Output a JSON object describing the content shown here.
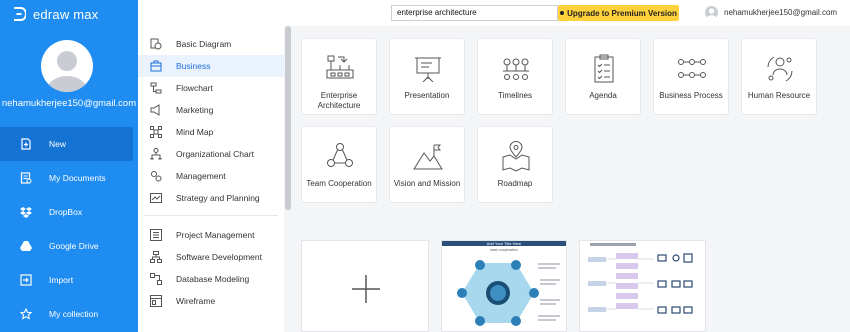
{
  "app": {
    "name": "edraw max"
  },
  "user": {
    "email": "nehamukherjee150@gmail.com"
  },
  "sidebar": {
    "items": [
      {
        "label": "New",
        "icon": "new-file-icon"
      },
      {
        "label": "My Documents",
        "icon": "documents-icon"
      },
      {
        "label": "DropBox",
        "icon": "dropbox-icon"
      },
      {
        "label": "Google Drive",
        "icon": "google-drive-icon"
      },
      {
        "label": "Import",
        "icon": "import-icon"
      },
      {
        "label": "My collection",
        "icon": "collection-icon"
      }
    ]
  },
  "topbar": {
    "search_value": "enterprise architecture",
    "upgrade_label": "Upgrade to Premium Version"
  },
  "categories": {
    "group1": [
      {
        "label": "Basic Diagram",
        "icon": "basic-diagram-icon"
      },
      {
        "label": "Business",
        "icon": "business-icon"
      },
      {
        "label": "Flowchart",
        "icon": "flowchart-icon"
      },
      {
        "label": "Marketing",
        "icon": "marketing-icon"
      },
      {
        "label": "Mind Map",
        "icon": "mind-map-icon"
      },
      {
        "label": "Organizational Chart",
        "icon": "org-chart-icon"
      },
      {
        "label": "Management",
        "icon": "management-icon"
      },
      {
        "label": "Strategy and Planning",
        "icon": "strategy-icon"
      }
    ],
    "group2": [
      {
        "label": "Project Management",
        "icon": "project-management-icon"
      },
      {
        "label": "Software Development",
        "icon": "software-development-icon"
      },
      {
        "label": "Database Modeling",
        "icon": "database-icon"
      },
      {
        "label": "Wireframe",
        "icon": "wireframe-icon"
      }
    ]
  },
  "templates": {
    "row1": [
      {
        "label": "Enterprise Architecture",
        "icon": "enterprise-architecture-icon"
      },
      {
        "label": "Presentation",
        "icon": "presentation-icon"
      },
      {
        "label": "Timelines",
        "icon": "timelines-icon"
      },
      {
        "label": "Agenda",
        "icon": "agenda-icon"
      },
      {
        "label": "Business Process",
        "icon": "business-process-icon"
      },
      {
        "label": "Human Resource",
        "icon": "human-resource-icon"
      }
    ],
    "row2": [
      {
        "label": "Team Cooperation",
        "icon": "team-cooperation-icon"
      },
      {
        "label": "Vision and Mission",
        "icon": "vision-mission-icon"
      },
      {
        "label": "Roadmap",
        "icon": "roadmap-icon"
      }
    ]
  },
  "previews": {
    "blank_icon": "plus-icon",
    "card1": {
      "title": "Add Your Title Here",
      "subtitle": "team cooperation"
    }
  },
  "colors": {
    "sidebar": "#1e8cf0",
    "sidebar_active": "#1573d4",
    "accent_yellow": "#ffd23c",
    "active_category_text": "#1e6fd6"
  }
}
